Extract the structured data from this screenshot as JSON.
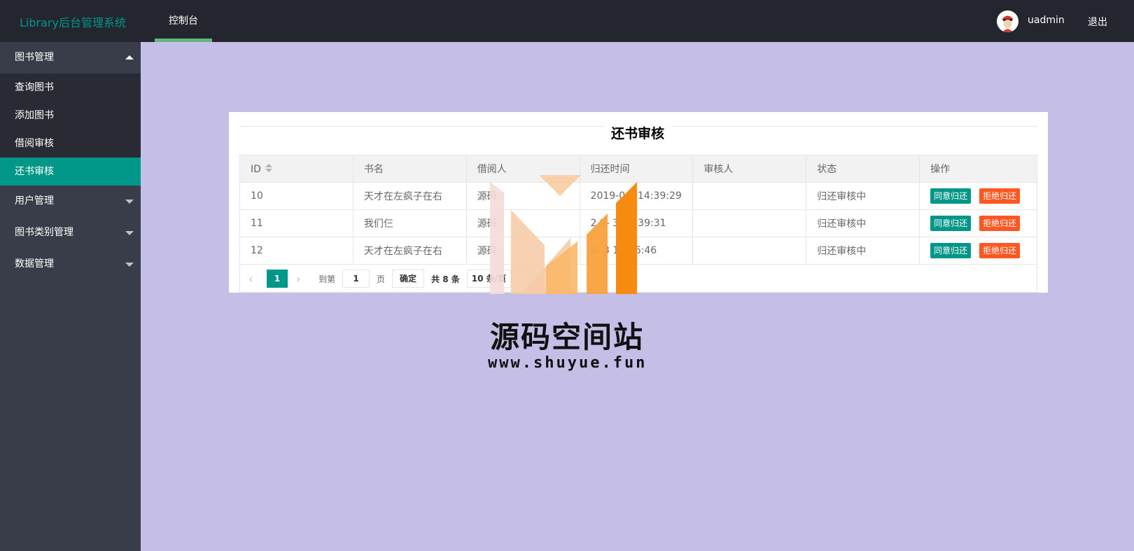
{
  "header": {
    "logo": "Library后台管理系统",
    "nav_tab": "控制台",
    "username": "uadmin",
    "logout": "退出"
  },
  "sidebar": {
    "groups": [
      {
        "label": "图书管理",
        "expanded": true,
        "items": [
          {
            "label": "查询图书"
          },
          {
            "label": "添加图书"
          },
          {
            "label": "借阅审核"
          },
          {
            "label": "还书审核",
            "active": true
          }
        ]
      },
      {
        "label": "用户管理"
      },
      {
        "label": "图书类别管理"
      },
      {
        "label": "数据管理"
      }
    ]
  },
  "panel": {
    "title": "还书审核",
    "columns": [
      "ID",
      "书名",
      "借阅人",
      "归还时间",
      "审核人",
      "状态",
      "操作"
    ],
    "rows": [
      {
        "id": "10",
        "book": "天才在左疯子在右",
        "borrower": "源码",
        "return_time": "2019-0  3 14:39:29",
        "reviewer": "",
        "status": "归还审核中"
      },
      {
        "id": "11",
        "book": "我们仨",
        "borrower": "源码",
        "return_time": "2 9-  3 14:39:31",
        "reviewer": "",
        "status": "归还审核中"
      },
      {
        "id": "12",
        "book": "天才在左疯子在右",
        "borrower": "源码",
        "return_time": "  9-  3 14:56:46",
        "reviewer": "",
        "status": "归还审核中"
      }
    ],
    "approve_label": "同意归还",
    "reject_label": "拒绝归还",
    "pager": {
      "current": "1",
      "goto_prefix": "到第",
      "goto_value": "1",
      "goto_suffix": "页",
      "confirm": "确定",
      "total": "共 8 条",
      "page_size": "10 条/页"
    }
  },
  "watermark": {
    "title": "源码空间站",
    "url": "www.shuyue.fun"
  },
  "colors": {
    "header_bg": "#23262e",
    "sidebar_bg": "#393d49",
    "accent": "#009688",
    "danger": "#ff5722",
    "page_bg": "#c5bee6"
  }
}
